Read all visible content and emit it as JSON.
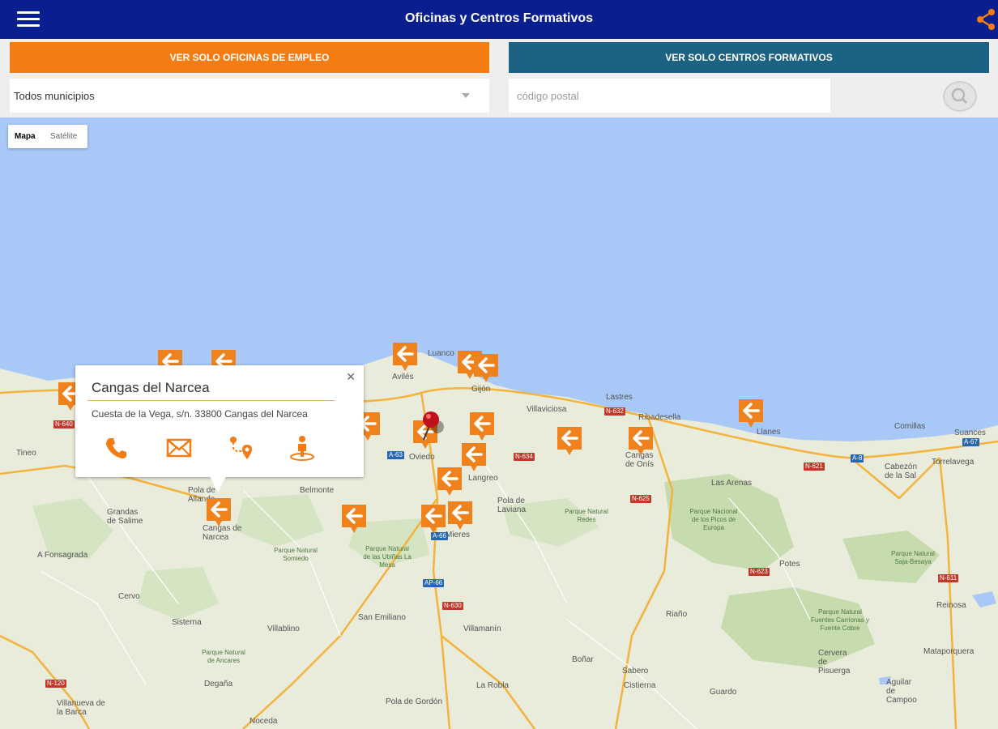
{
  "header": {
    "title": "Oficinas y Centros Formativos",
    "menu_icon": "hamburger-menu-icon",
    "share_icon": "share-icon"
  },
  "filters": {
    "oficinas_label": "VER SOLO OFICINAS DE EMPLEO",
    "centros_label": "VER SOLO CENTROS FORMATIVOS",
    "municipio_value": "Todos municipios",
    "cp_placeholder": "código postal",
    "search_icon": "search-icon",
    "colors": {
      "oficinas": "#f47c13",
      "centros": "#1c6283",
      "header": "#0a1f8f"
    }
  },
  "map": {
    "type_mapa": "Mapa",
    "type_satelite": "Satélite",
    "places": [
      "Luanco",
      "Avilés",
      "Gijón",
      "Villaviciosa",
      "Lastres",
      "Ribadesella",
      "Llanes",
      "Oviedo",
      "Langreo",
      "Pola de Laviana",
      "Mieres",
      "Cangas de Onís",
      "Cangas de Narcea",
      "Pola de Allande",
      "Belmonte",
      "Grandas de Salime",
      "Tineo",
      "A Fonsagrada",
      "Cervo",
      "Sisterna",
      "Villablino",
      "San Emiliano",
      "Villamanín",
      "La Robla",
      "Boñar",
      "Sabero",
      "Cistierna",
      "Guardo",
      "Riaño",
      "Potes",
      "Las Arenas",
      "Comillas",
      "Suances",
      "Torrelavega",
      "Cabezón de la Sal",
      "Reinosa",
      "Aguilar de Campoo",
      "Cervera de Pisuerga",
      "Villanueva de la Barca",
      "Degaña",
      "Noceda",
      "Pola de Gordón",
      "Mataporquera"
    ],
    "parks": [
      "Parque Natural Somiedo",
      "Parque Natural de las Ubiñas La Mesa",
      "Parque Natural Redes",
      "Parque Nacional de los Picos de Europa",
      "Parque Natural Saja-Besaya",
      "Parque Natural Fuentes Carrionas y Fuente Cobre",
      "Parque Natural de Ancares"
    ],
    "roads": [
      "N-640",
      "A-8",
      "N-634",
      "A-63",
      "N-632",
      "A-66",
      "AP-66",
      "N-630",
      "N-621",
      "N-611",
      "A-67",
      "N-625",
      "N-623",
      "N-120"
    ],
    "marker_icon": "office-arrow-marker-icon",
    "pin_icon": "map-pin-icon"
  },
  "infowindow": {
    "name": "Cangas del Narcea",
    "address": "Cuesta de la Vega, s/n. 33800 Cangas del Narcea",
    "actions": [
      "phone-icon",
      "email-icon",
      "route-icon",
      "streetview-icon"
    ]
  }
}
